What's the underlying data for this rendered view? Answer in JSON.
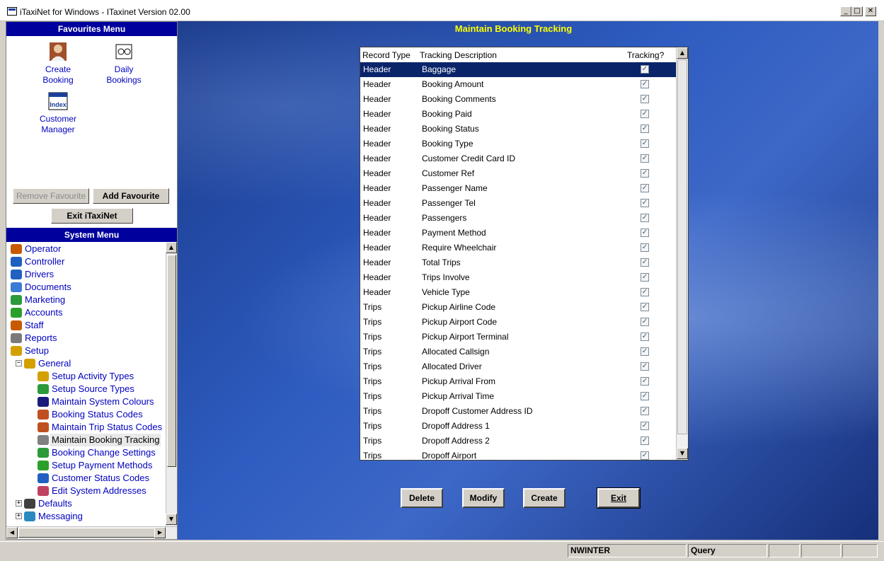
{
  "window": {
    "title": "iTaxiNet for Windows - ITaxinet Version 02.00",
    "min": "_",
    "max": "□",
    "close": "✕"
  },
  "favourites": {
    "header": "Favourites Menu",
    "items": [
      {
        "line1": "Create",
        "line2": "Booking",
        "icon": "person-photo-icon"
      },
      {
        "line1": "Daily",
        "line2": "Bookings",
        "icon": "binoculars-icon"
      },
      {
        "line1": "Customer",
        "line2": "Manager",
        "icon": "index-card-icon",
        "icon_text": "Index"
      }
    ],
    "remove_label": "Remove Favourite",
    "add_label": "Add Favourite",
    "exit_label": "Exit iTaxiNet"
  },
  "system_menu": {
    "header": "System Menu",
    "items": [
      {
        "label": "Operator",
        "icon": "operator-icon",
        "color": "#c85a00"
      },
      {
        "label": "Controller",
        "icon": "controller-icon",
        "color": "#2060c0"
      },
      {
        "label": "Drivers",
        "icon": "drivers-icon",
        "color": "#2060c0"
      },
      {
        "label": "Documents",
        "icon": "documents-icon",
        "color": "#3a7bd5"
      },
      {
        "label": "Marketing",
        "icon": "marketing-icon",
        "color": "#2a9a3a"
      },
      {
        "label": "Accounts",
        "icon": "accounts-icon",
        "color": "#2aa02a"
      },
      {
        "label": "Staff",
        "icon": "staff-icon",
        "color": "#c85a00"
      },
      {
        "label": "Reports",
        "icon": "reports-icon",
        "color": "#7a7a7a"
      },
      {
        "label": "Setup",
        "icon": "setup-icon",
        "color": "#d4a000"
      },
      {
        "label": "General",
        "icon": "general-icon",
        "color": "#d4a000"
      },
      {
        "label": "Setup Activity Types",
        "icon": "activity-types-icon",
        "color": "#d4a000"
      },
      {
        "label": "Setup Source Types",
        "icon": "source-types-icon",
        "color": "#2a9a3a"
      },
      {
        "label": "Maintain System Colours",
        "icon": "info-icon",
        "color": "#1a1a7a"
      },
      {
        "label": "Booking Status Codes",
        "icon": "status-codes-icon",
        "color": "#c05020"
      },
      {
        "label": "Maintain Trip Status Codes",
        "icon": "trip-status-icon",
        "color": "#c05020"
      },
      {
        "label": "Maintain Booking Tracking",
        "icon": "booking-tracking-icon",
        "color": "#808080"
      },
      {
        "label": "Booking Change Settings",
        "icon": "change-settings-icon",
        "color": "#2a9a3a"
      },
      {
        "label": "Setup Payment Methods",
        "icon": "payment-methods-icon",
        "color": "#2aa02a"
      },
      {
        "label": "Customer Status Codes",
        "icon": "customer-status-icon",
        "color": "#2060c0"
      },
      {
        "label": "Edit System Addresses",
        "icon": "addresses-icon",
        "color": "#c04060"
      },
      {
        "label": "Defaults",
        "icon": "defaults-icon",
        "color": "#404040"
      },
      {
        "label": "Messaging",
        "icon": "messaging-icon",
        "color": "#2a8ac0"
      }
    ]
  },
  "main": {
    "title": "Maintain Booking Tracking",
    "columns": [
      "Record Type",
      "Tracking Description",
      "Tracking?"
    ],
    "rows": [
      {
        "type": "Header",
        "desc": "Baggage",
        "tracking": true
      },
      {
        "type": "Header",
        "desc": "Booking Amount",
        "tracking": true
      },
      {
        "type": "Header",
        "desc": "Booking Comments",
        "tracking": true
      },
      {
        "type": "Header",
        "desc": "Booking Paid",
        "tracking": true
      },
      {
        "type": "Header",
        "desc": "Booking Status",
        "tracking": true
      },
      {
        "type": "Header",
        "desc": "Booking Type",
        "tracking": true
      },
      {
        "type": "Header",
        "desc": "Customer Credit Card ID",
        "tracking": true
      },
      {
        "type": "Header",
        "desc": "Customer Ref",
        "tracking": true
      },
      {
        "type": "Header",
        "desc": "Passenger Name",
        "tracking": true
      },
      {
        "type": "Header",
        "desc": "Passenger Tel",
        "tracking": true
      },
      {
        "type": "Header",
        "desc": "Passengers",
        "tracking": true
      },
      {
        "type": "Header",
        "desc": "Payment Method",
        "tracking": true
      },
      {
        "type": "Header",
        "desc": "Require Wheelchair",
        "tracking": true
      },
      {
        "type": "Header",
        "desc": "Total Trips",
        "tracking": true
      },
      {
        "type": "Header",
        "desc": "Trips Involve",
        "tracking": true
      },
      {
        "type": "Header",
        "desc": "Vehicle Type",
        "tracking": true
      },
      {
        "type": "Trips",
        "desc": "Pickup Airline Code",
        "tracking": true
      },
      {
        "type": "Trips",
        "desc": "Pickup Airport Code",
        "tracking": true
      },
      {
        "type": "Trips",
        "desc": "Pickup Airport Terminal",
        "tracking": true
      },
      {
        "type": "Trips",
        "desc": "Allocated Callsign",
        "tracking": true
      },
      {
        "type": "Trips",
        "desc": "Allocated Driver",
        "tracking": true
      },
      {
        "type": "Trips",
        "desc": "Pickup Arrival From",
        "tracking": true
      },
      {
        "type": "Trips",
        "desc": "Pickup Arrival Time",
        "tracking": true
      },
      {
        "type": "Trips",
        "desc": "Dropoff Customer Address ID",
        "tracking": true
      },
      {
        "type": "Trips",
        "desc": "Dropoff Address 1",
        "tracking": true
      },
      {
        "type": "Trips",
        "desc": "Dropoff Address 2",
        "tracking": true
      },
      {
        "type": "Trips",
        "desc": "Dropoff Airport",
        "tracking": true
      }
    ],
    "buttons": {
      "delete": "Delete",
      "modify": "Modify",
      "create": "Create",
      "exit": "Exit"
    }
  },
  "status": {
    "user": "NWINTER",
    "mode": "Query"
  },
  "colors": {
    "menu_header": "#00009c",
    "main_title": "#ffff00",
    "selection": "#0a246a",
    "link": "#0000c0"
  }
}
